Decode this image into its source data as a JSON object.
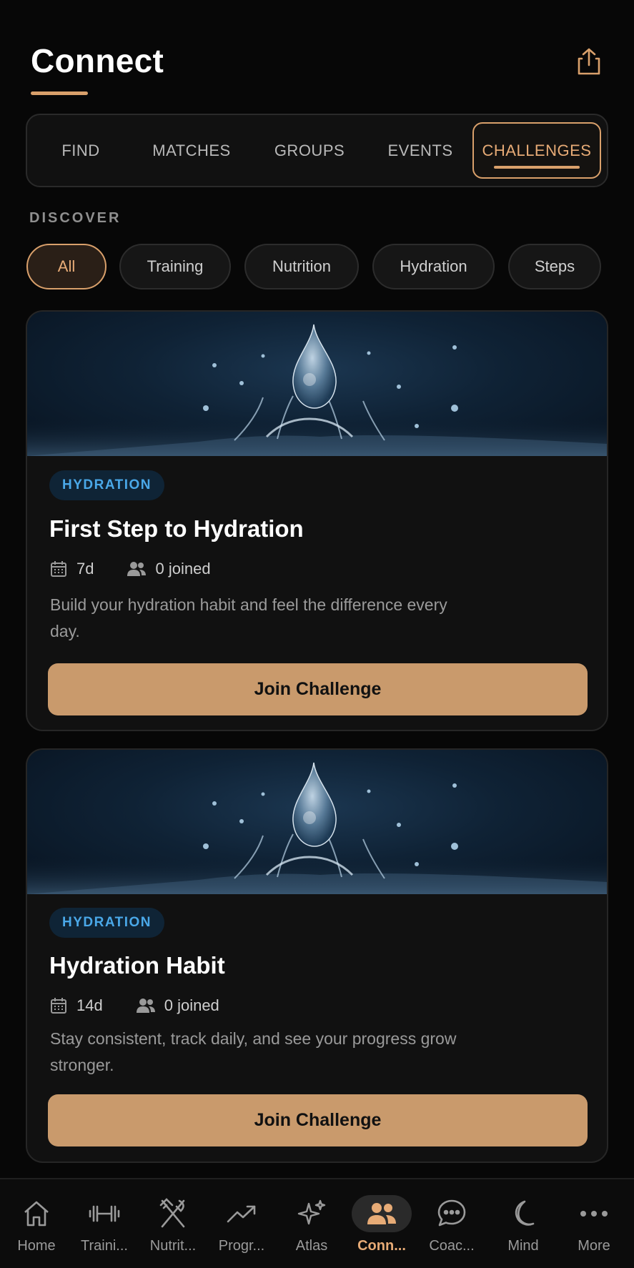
{
  "header": {
    "title": "Connect",
    "share_icon": "share-icon"
  },
  "tabs": [
    {
      "label": "FIND",
      "active": false
    },
    {
      "label": "MATCHES",
      "active": false
    },
    {
      "label": "GROUPS",
      "active": false
    },
    {
      "label": "EVENTS",
      "active": false
    },
    {
      "label": "CHALLENGES",
      "active": true
    }
  ],
  "discover": {
    "label": "DISCOVER",
    "chips": [
      {
        "label": "All",
        "active": true
      },
      {
        "label": "Training",
        "active": false
      },
      {
        "label": "Nutrition",
        "active": false
      },
      {
        "label": "Hydration",
        "active": false
      },
      {
        "label": "Steps",
        "active": false
      }
    ]
  },
  "challenges": [
    {
      "category": "HYDRATION",
      "title": "First Step to Hydration",
      "duration": "7d",
      "joined": "0 joined",
      "description": "Build your hydration habit and feel the difference every day.",
      "button_label": "Join Challenge"
    },
    {
      "category": "HYDRATION",
      "title": "Hydration Habit",
      "duration": "14d",
      "joined": "0 joined",
      "description": "Stay consistent, track daily, and see your progress grow stronger.",
      "button_label": "Join Challenge"
    }
  ],
  "bottom_nav": [
    {
      "label": "Home",
      "icon": "home-icon",
      "active": false
    },
    {
      "label": "Traini...",
      "icon": "dumbbell-icon",
      "active": false
    },
    {
      "label": "Nutrit...",
      "icon": "utensils-icon",
      "active": false
    },
    {
      "label": "Progr...",
      "icon": "trending-up-icon",
      "active": false
    },
    {
      "label": "Atlas",
      "icon": "sparkles-icon",
      "active": false
    },
    {
      "label": "Conn...",
      "icon": "users-icon",
      "active": true
    },
    {
      "label": "Coac...",
      "icon": "chat-bubble-icon",
      "active": false
    },
    {
      "label": "Mind",
      "icon": "moon-icon",
      "active": false
    },
    {
      "label": "More",
      "icon": "more-dots-icon",
      "active": false
    }
  ],
  "colors": {
    "accent": "#d9a06b",
    "button": "#c99a6c",
    "badge_text": "#4aa8e8",
    "background": "#070707"
  }
}
